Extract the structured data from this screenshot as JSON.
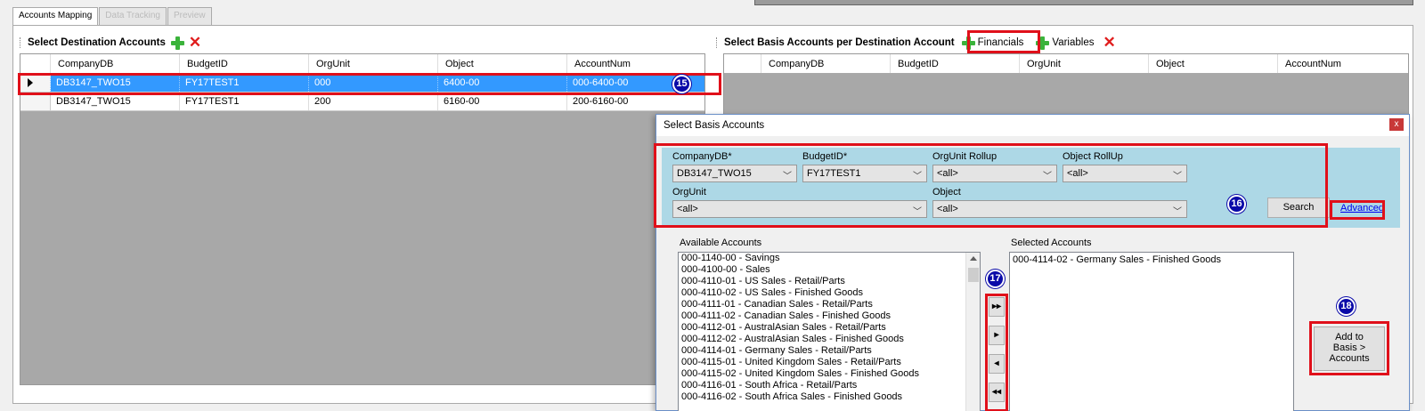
{
  "tabs": [
    {
      "label": "Accounts Mapping",
      "active": true
    },
    {
      "label": "Data Tracking",
      "active": false
    },
    {
      "label": "Preview",
      "active": false
    }
  ],
  "left_panel": {
    "title": "Select Destination Accounts",
    "columns": [
      "CompanyDB",
      "BudgetID",
      "OrgUnit",
      "Object",
      "AccountNum"
    ],
    "rows": [
      {
        "cells": [
          "DB3147_TWO15",
          "FY17TEST1",
          "000",
          "6400-00",
          "000-6400-00"
        ],
        "selected": true
      },
      {
        "cells": [
          "DB3147_TWO15",
          "FY17TEST1",
          "200",
          "6160-00",
          "200-6160-00"
        ],
        "selected": false
      }
    ]
  },
  "right_panel": {
    "title": "Select Basis Accounts per Destination Account",
    "financials_label": "Financials",
    "variables_label": "Variables",
    "columns": [
      "CompanyDB",
      "BudgetID",
      "OrgUnit",
      "Object",
      "AccountNum"
    ]
  },
  "dialog": {
    "title": "Select Basis Accounts",
    "close_label": "x",
    "filters": {
      "companydb": {
        "label": "CompanyDB*",
        "value": "DB3147_TWO15"
      },
      "budgetid": {
        "label": "BudgetID*",
        "value": "FY17TEST1"
      },
      "orgunit_rollup": {
        "label": "OrgUnit Rollup",
        "value": "<all>"
      },
      "object_rollup": {
        "label": "Object RollUp",
        "value": "<all>"
      },
      "orgunit": {
        "label": "OrgUnit",
        "value": "<all>"
      },
      "object": {
        "label": "Object",
        "value": "<all>"
      }
    },
    "search_label": "Search",
    "advanced_label": "Advanced",
    "available_label": "Available Accounts",
    "available_accounts": [
      "000-1140-00 - Savings",
      "000-4100-00 - Sales",
      "000-4110-01 - US Sales - Retail/Parts",
      "000-4110-02 - US Sales - Finished Goods",
      "000-4111-01 - Canadian Sales - Retail/Parts",
      "000-4111-02 - Canadian Sales - Finished Goods",
      "000-4112-01 - AustralAsian Sales - Retail/Parts",
      "000-4112-02 - AustralAsian Sales - Finished Goods",
      "000-4114-01 - Germany Sales - Retail/Parts",
      "000-4115-01 - United Kingdom Sales - Retail/Parts",
      "000-4115-02 - United Kingdom Sales - Finished Goods",
      "000-4116-01 - South Africa - Retail/Parts",
      "000-4116-02 - South Africa Sales - Finished Goods"
    ],
    "selected_label": "Selected Accounts",
    "selected_accounts": [
      "000-4114-02 - Germany Sales - Finished Goods"
    ],
    "move_buttons": [
      "▸▸",
      "▸",
      "◂",
      "◂◂"
    ],
    "add_button": {
      "line1": "Add to",
      "line2": "Basis  >",
      "line3": "Accounts"
    }
  },
  "badges": [
    "15",
    "16",
    "17",
    "18"
  ],
  "colors": {
    "highlight": "#e0101a",
    "selection": "#3399ff",
    "filter_bg": "#add8e6",
    "badge": "#0a0aa8"
  }
}
